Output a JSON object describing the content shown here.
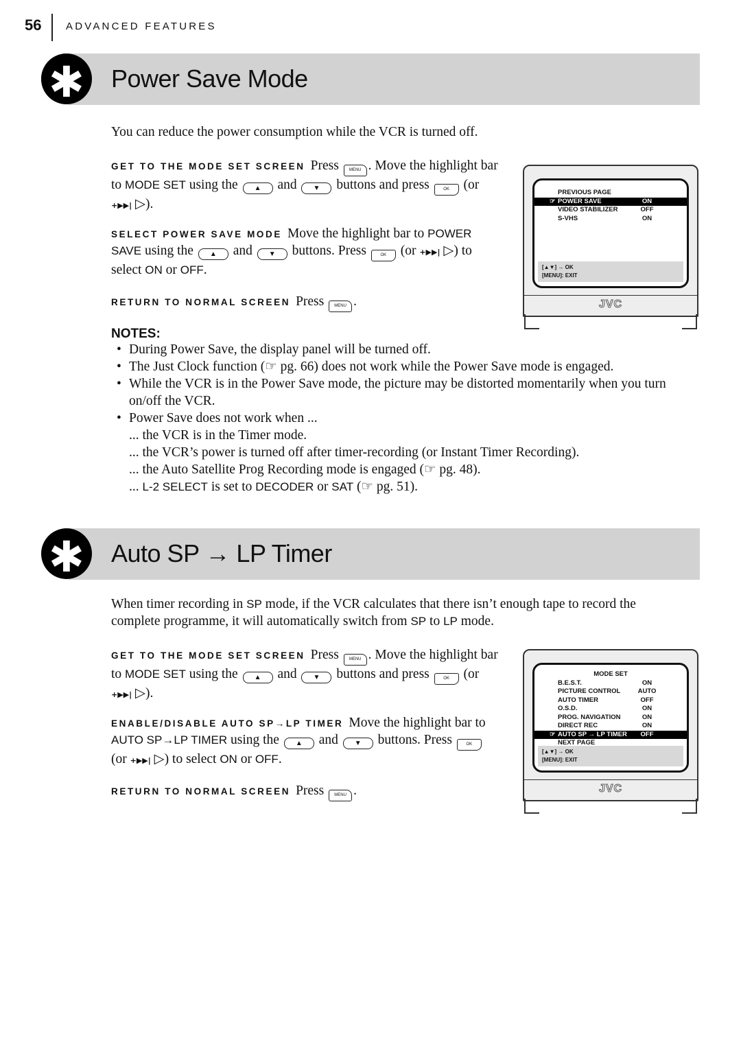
{
  "header": {
    "page_number": "56",
    "chapter": "ADVANCED FEATURES"
  },
  "sections": [
    {
      "title": "Power Save Mode",
      "intro": [
        [
          {
            "t": "You can reduce the power consumption while the VCR is turned off."
          }
        ]
      ],
      "steps": [
        {
          "label": "GET TO THE MODE SET SCREEN",
          "text": [
            {
              "t": "Press "
            },
            {
              "icon": "menu"
            },
            {
              "t": ". Move the highlight bar to "
            },
            {
              "b": "MODE SET"
            },
            {
              "t": " using the "
            },
            {
              "icon": "up"
            },
            {
              "t": " and "
            },
            {
              "icon": "dn"
            },
            {
              "t": " buttons and press "
            },
            {
              "icon": "ok"
            },
            {
              "t": " (or "
            },
            {
              "icon": "skip"
            },
            {
              "t": " ▷)."
            }
          ]
        },
        {
          "label": "SELECT POWER SAVE MODE",
          "text": [
            {
              "t": "Move the highlight bar to "
            },
            {
              "b": "POWER SAVE"
            },
            {
              "t": " using the "
            },
            {
              "icon": "up"
            },
            {
              "t": " and "
            },
            {
              "icon": "dn"
            },
            {
              "t": " buttons. Press "
            },
            {
              "icon": "ok"
            },
            {
              "t": " (or "
            },
            {
              "icon": "skip"
            },
            {
              "t": " ▷) to select "
            },
            {
              "b": "ON"
            },
            {
              "t": " or "
            },
            {
              "b": "OFF"
            },
            {
              "t": "."
            }
          ]
        },
        {
          "label": "RETURN TO NORMAL SCREEN",
          "text": [
            {
              "t": "Press "
            },
            {
              "icon": "menu"
            },
            {
              "t": "."
            }
          ]
        }
      ],
      "notes_heading": "NOTES:",
      "notes": [
        [
          {
            "t": "During Power Save, the display panel will be turned off."
          }
        ],
        [
          {
            "t": "The Just Clock function ("
          },
          {
            "t": "☞"
          },
          {
            "t": " pg. 66) does not work while the Power Save mode is engaged."
          }
        ],
        [
          {
            "t": "While the VCR is in the Power Save mode, the picture may be distorted momentarily when you turn on/off the VCR."
          }
        ],
        [
          {
            "t": "Power Save does not work when ..."
          }
        ]
      ],
      "subnotes": [
        [
          {
            "t": "... the VCR is in the Timer mode."
          }
        ],
        [
          {
            "t": "... the VCR’s power is turned off after timer-recording (or Instant Timer Recording)."
          }
        ],
        [
          {
            "t": "... the Auto Satellite Prog Recording mode is engaged ("
          },
          {
            "t": "☞"
          },
          {
            "t": " pg. 48)."
          }
        ],
        [
          {
            "t": "... "
          },
          {
            "b": "L-2 SELECT"
          },
          {
            "t": " is set to "
          },
          {
            "b": "DECODER"
          },
          {
            "t": " or "
          },
          {
            "b": "SAT"
          },
          {
            "t": " ("
          },
          {
            "t": "☞"
          },
          {
            "t": " pg. 51)."
          }
        ]
      ],
      "tv": {
        "heading": "",
        "rows": [
          {
            "label": "PREVIOUS PAGE",
            "value": ""
          },
          {
            "label": "POWER SAVE",
            "value": "ON",
            "highlight": true
          },
          {
            "label": "VIDEO STABILIZER",
            "value": "OFF"
          },
          {
            "label": "S-VHS",
            "value": "ON"
          }
        ],
        "footer1": "[▲▼] → OK",
        "footer2": "[MENU]: EXIT",
        "logo": "JVC"
      }
    },
    {
      "title": "Auto SP → LP Timer",
      "intro": [
        [
          {
            "t": "When timer recording in "
          },
          {
            "b": "SP"
          },
          {
            "t": " mode, if the VCR calculates that there isn’t enough tape to record the complete programme, it will automatically switch from "
          },
          {
            "b": "SP"
          },
          {
            "t": " to "
          },
          {
            "b": "LP"
          },
          {
            "t": " mode."
          }
        ]
      ],
      "steps": [
        {
          "label": "GET TO THE MODE SET SCREEN",
          "text": [
            {
              "t": "Press "
            },
            {
              "icon": "menu"
            },
            {
              "t": ". Move the highlight bar to "
            },
            {
              "b": "MODE SET"
            },
            {
              "t": " using the "
            },
            {
              "icon": "up"
            },
            {
              "t": " and "
            },
            {
              "icon": "dn"
            },
            {
              "t": " buttons and press "
            },
            {
              "icon": "ok"
            },
            {
              "t": " (or "
            },
            {
              "icon": "skip"
            },
            {
              "t": " ▷)."
            }
          ]
        },
        {
          "label": "ENABLE/DISABLE AUTO SP→LP TIMER",
          "text": [
            {
              "t": "Move the highlight bar to "
            },
            {
              "b": "AUTO SP→LP TIMER"
            },
            {
              "t": " using the "
            },
            {
              "icon": "up"
            },
            {
              "t": " and "
            },
            {
              "icon": "dn"
            },
            {
              "t": " buttons. Press "
            },
            {
              "icon": "ok"
            },
            {
              "t": " (or "
            },
            {
              "icon": "skip"
            },
            {
              "t": " ▷) to select "
            },
            {
              "b": "ON"
            },
            {
              "t": " or "
            },
            {
              "b": "OFF"
            },
            {
              "t": "."
            }
          ]
        },
        {
          "label": "RETURN TO NORMAL SCREEN",
          "text": [
            {
              "t": "Press "
            },
            {
              "icon": "menu"
            },
            {
              "t": "."
            }
          ]
        }
      ],
      "tv": {
        "heading": "MODE SET",
        "rows": [
          {
            "label": "B.E.S.T.",
            "value": "ON"
          },
          {
            "label": "PICTURE CONTROL",
            "value": "AUTO"
          },
          {
            "label": "AUTO TIMER",
            "value": "OFF"
          },
          {
            "label": "O.S.D.",
            "value": "ON"
          },
          {
            "label": "PROG. NAVIGATION",
            "value": "ON"
          },
          {
            "label": "DIRECT REC",
            "value": "ON"
          },
          {
            "label": "AUTO SP → LP TIMER",
            "value": "OFF",
            "highlight": true
          },
          {
            "label": "NEXT PAGE",
            "value": ""
          }
        ],
        "footer1": "[▲▼] → OK",
        "footer2": "[MENU]: EXIT",
        "logo": "JVC"
      }
    }
  ],
  "icons": {
    "menu": "MENU",
    "up": "▲",
    "dn": "▼",
    "ok": "OK",
    "skip": "+▶▶|",
    "pointer": "☞",
    "badge": "✱"
  }
}
